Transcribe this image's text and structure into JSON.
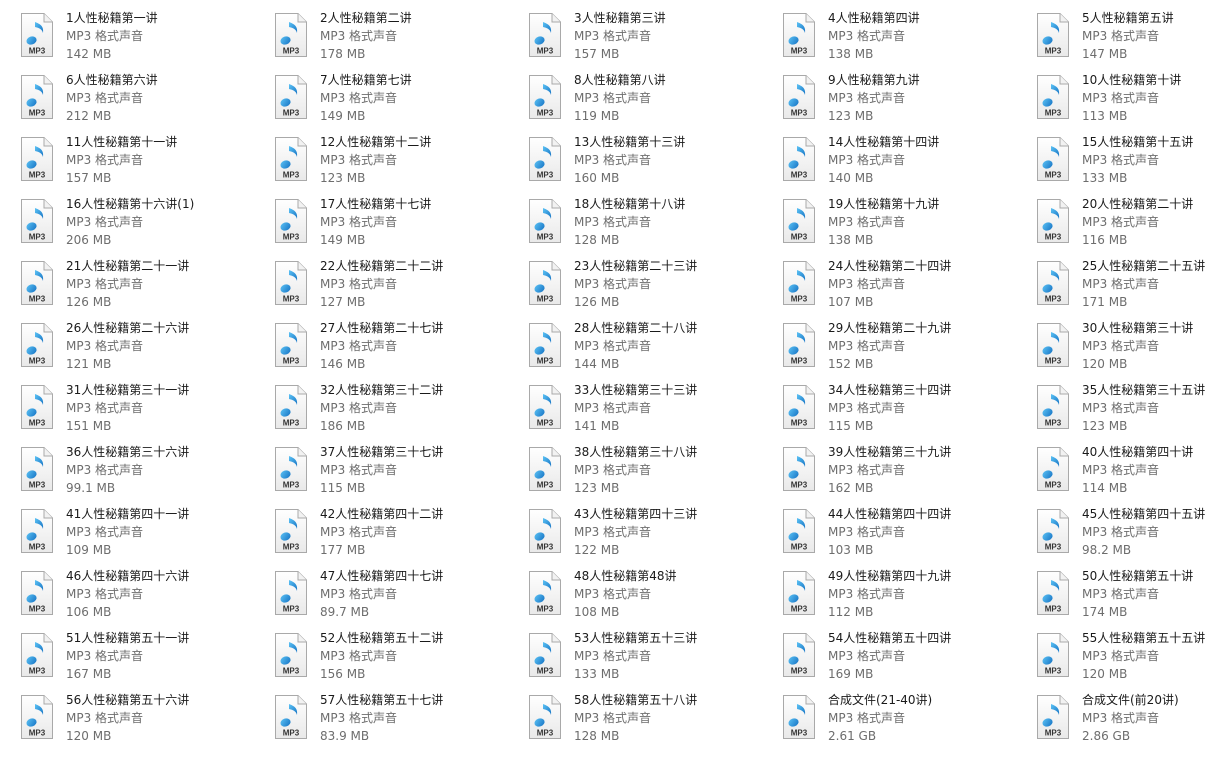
{
  "files": [
    {
      "name": "1人性秘籍第一讲",
      "type": "MP3 格式声音",
      "size": "142 MB"
    },
    {
      "name": "2人性秘籍第二讲",
      "type": "MP3 格式声音",
      "size": "178 MB"
    },
    {
      "name": "3人性秘籍第三讲",
      "type": "MP3 格式声音",
      "size": "157 MB"
    },
    {
      "name": "4人性秘籍第四讲",
      "type": "MP3 格式声音",
      "size": "138 MB"
    },
    {
      "name": "5人性秘籍第五讲",
      "type": "MP3 格式声音",
      "size": "147 MB"
    },
    {
      "name": "6人性秘籍第六讲",
      "type": "MP3 格式声音",
      "size": "212 MB"
    },
    {
      "name": "7人性秘籍第七讲",
      "type": "MP3 格式声音",
      "size": "149 MB"
    },
    {
      "name": "8人性秘籍第八讲",
      "type": "MP3 格式声音",
      "size": "119 MB"
    },
    {
      "name": "9人性秘籍第九讲",
      "type": "MP3 格式声音",
      "size": "123 MB"
    },
    {
      "name": "10人性秘籍第十讲",
      "type": "MP3 格式声音",
      "size": "113 MB"
    },
    {
      "name": "11人性秘籍第十一讲",
      "type": "MP3 格式声音",
      "size": "157 MB"
    },
    {
      "name": "12人性秘籍第十二讲",
      "type": "MP3 格式声音",
      "size": "123 MB"
    },
    {
      "name": "13人性秘籍第十三讲",
      "type": "MP3 格式声音",
      "size": "160 MB"
    },
    {
      "name": "14人性秘籍第十四讲",
      "type": "MP3 格式声音",
      "size": "140 MB"
    },
    {
      "name": "15人性秘籍第十五讲",
      "type": "MP3 格式声音",
      "size": "133 MB"
    },
    {
      "name": "16人性秘籍第十六讲(1)",
      "type": "MP3 格式声音",
      "size": "206 MB"
    },
    {
      "name": "17人性秘籍第十七讲",
      "type": "MP3 格式声音",
      "size": "149 MB"
    },
    {
      "name": "18人性秘籍第十八讲",
      "type": "MP3 格式声音",
      "size": "128 MB"
    },
    {
      "name": "19人性秘籍第十九讲",
      "type": "MP3 格式声音",
      "size": "138 MB"
    },
    {
      "name": "20人性秘籍第二十讲",
      "type": "MP3 格式声音",
      "size": "116 MB"
    },
    {
      "name": "21人性秘籍第二十一讲",
      "type": "MP3 格式声音",
      "size": "126 MB"
    },
    {
      "name": "22人性秘籍第二十二讲",
      "type": "MP3 格式声音",
      "size": "127 MB"
    },
    {
      "name": "23人性秘籍第二十三讲",
      "type": "MP3 格式声音",
      "size": "126 MB"
    },
    {
      "name": "24人性秘籍第二十四讲",
      "type": "MP3 格式声音",
      "size": "107 MB"
    },
    {
      "name": "25人性秘籍第二十五讲",
      "type": "MP3 格式声音",
      "size": "171 MB"
    },
    {
      "name": "26人性秘籍第二十六讲",
      "type": "MP3 格式声音",
      "size": "121 MB"
    },
    {
      "name": "27人性秘籍第二十七讲",
      "type": "MP3 格式声音",
      "size": "146 MB"
    },
    {
      "name": "28人性秘籍第二十八讲",
      "type": "MP3 格式声音",
      "size": "144 MB"
    },
    {
      "name": "29人性秘籍第二十九讲",
      "type": "MP3 格式声音",
      "size": "152 MB"
    },
    {
      "name": "30人性秘籍第三十讲",
      "type": "MP3 格式声音",
      "size": "120 MB"
    },
    {
      "name": "31人性秘籍第三十一讲",
      "type": "MP3 格式声音",
      "size": "151 MB"
    },
    {
      "name": "32人性秘籍第三十二讲",
      "type": "MP3 格式声音",
      "size": "186 MB"
    },
    {
      "name": "33人性秘籍第三十三讲",
      "type": "MP3 格式声音",
      "size": "141 MB"
    },
    {
      "name": "34人性秘籍第三十四讲",
      "type": "MP3 格式声音",
      "size": "115 MB"
    },
    {
      "name": "35人性秘籍第三十五讲",
      "type": "MP3 格式声音",
      "size": "123 MB"
    },
    {
      "name": "36人性秘籍第三十六讲",
      "type": "MP3 格式声音",
      "size": "99.1 MB"
    },
    {
      "name": "37人性秘籍第三十七讲",
      "type": "MP3 格式声音",
      "size": "115 MB"
    },
    {
      "name": "38人性秘籍第三十八讲",
      "type": "MP3 格式声音",
      "size": "123 MB"
    },
    {
      "name": "39人性秘籍第三十九讲",
      "type": "MP3 格式声音",
      "size": "162 MB"
    },
    {
      "name": "40人性秘籍第四十讲",
      "type": "MP3 格式声音",
      "size": "114 MB"
    },
    {
      "name": "41人性秘籍第四十一讲",
      "type": "MP3 格式声音",
      "size": "109 MB"
    },
    {
      "name": "42人性秘籍第四十二讲",
      "type": "MP3 格式声音",
      "size": "177 MB"
    },
    {
      "name": "43人性秘籍第四十三讲",
      "type": "MP3 格式声音",
      "size": "122 MB"
    },
    {
      "name": "44人性秘籍第四十四讲",
      "type": "MP3 格式声音",
      "size": "103 MB"
    },
    {
      "name": "45人性秘籍第四十五讲",
      "type": "MP3 格式声音",
      "size": "98.2 MB"
    },
    {
      "name": "46人性秘籍第四十六讲",
      "type": "MP3 格式声音",
      "size": "106 MB"
    },
    {
      "name": "47人性秘籍第四十七讲",
      "type": "MP3 格式声音",
      "size": "89.7 MB"
    },
    {
      "name": "48人性秘籍第48讲",
      "type": "MP3 格式声音",
      "size": "108 MB"
    },
    {
      "name": "49人性秘籍第四十九讲",
      "type": "MP3 格式声音",
      "size": "112 MB"
    },
    {
      "name": "50人性秘籍第五十讲",
      "type": "MP3 格式声音",
      "size": "174 MB"
    },
    {
      "name": "51人性秘籍第五十一讲",
      "type": "MP3 格式声音",
      "size": "167 MB"
    },
    {
      "name": "52人性秘籍第五十二讲",
      "type": "MP3 格式声音",
      "size": "156 MB"
    },
    {
      "name": "53人性秘籍第五十三讲",
      "type": "MP3 格式声音",
      "size": "133 MB"
    },
    {
      "name": "54人性秘籍第五十四讲",
      "type": "MP3 格式声音",
      "size": "169 MB"
    },
    {
      "name": "55人性秘籍第五十五讲",
      "type": "MP3 格式声音",
      "size": "120 MB"
    },
    {
      "name": "56人性秘籍第五十六讲",
      "type": "MP3 格式声音",
      "size": "120 MB"
    },
    {
      "name": "57人性秘籍第五十七讲",
      "type": "MP3 格式声音",
      "size": "83.9 MB"
    },
    {
      "name": "58人性秘籍第五十八讲",
      "type": "MP3 格式声音",
      "size": "128 MB"
    },
    {
      "name": "合成文件(21-40讲)",
      "type": "MP3 格式声音",
      "size": "2.61 GB"
    },
    {
      "name": "合成文件(前20讲)",
      "type": "MP3 格式声音",
      "size": "2.86 GB"
    }
  ],
  "icon": {
    "name": "mp3-file-icon",
    "label": "MP3",
    "note_color": "#1f8fd6"
  }
}
